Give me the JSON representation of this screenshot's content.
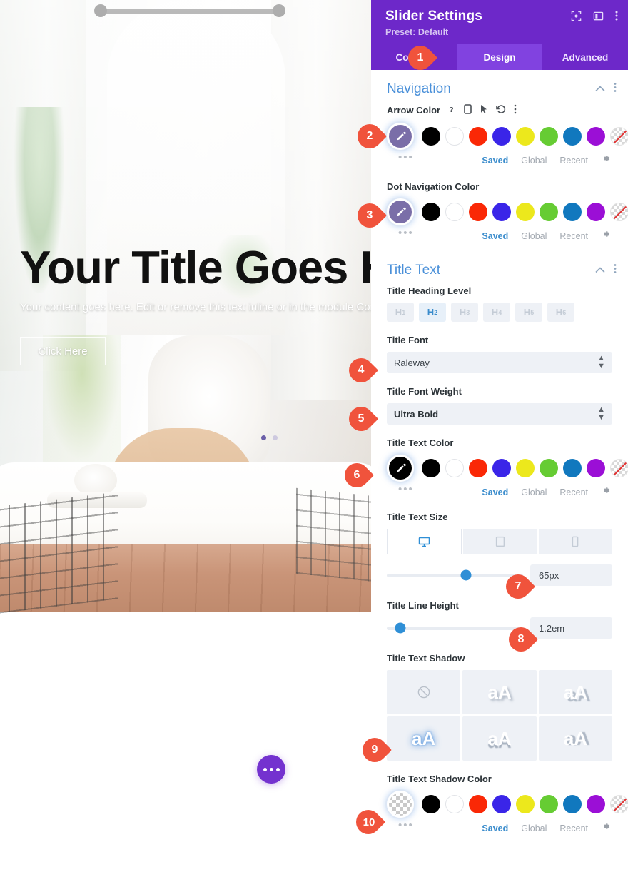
{
  "preview": {
    "title": "Your Title Goes Here",
    "body": "Your content goes here. Edit or remove this text inline or in the module Content settings. You can also style every aspect of this content in the module Design settings and even apply custom CSS to this text in the module Advanced settings.",
    "button_label": "Click Here",
    "fab_name": "more-options",
    "dots": [
      "active",
      "inactive"
    ]
  },
  "panel": {
    "title": "Slider Settings",
    "preset": "Preset: Default",
    "header_icons": [
      "focus-icon",
      "layout-icon",
      "kebab-menu-icon"
    ],
    "tabs": [
      {
        "label": "Content",
        "active": false
      },
      {
        "label": "Design",
        "active": true
      },
      {
        "label": "Advanced",
        "active": false
      }
    ]
  },
  "colors": {
    "accent_purple": "#6d28c9",
    "tab_active": "#8142e0",
    "section_blue": "#4a90d9",
    "badge_red": "#f0533c",
    "slider_knob": "#2f8fd6",
    "palette": [
      "#000000",
      "#ffffff",
      "#fa2806",
      "#3a25e8",
      "#ece81c",
      "#66cc33",
      "#1178be",
      "#9b0fd6",
      "transparent"
    ]
  },
  "palette_labels": [
    "black",
    "white",
    "red",
    "blue",
    "yellow",
    "green",
    "teal-blue",
    "purple",
    "transparent"
  ],
  "meta_row": {
    "saved": "Saved",
    "global": "Global",
    "recent": "Recent",
    "gear": "settings-gear-icon"
  },
  "navigation": {
    "section_title": "Navigation",
    "arrow_color": {
      "label": "Arrow Color",
      "icons": [
        "help-icon",
        "responsive-icon",
        "hover-icon",
        "reset-icon",
        "kebab-menu-icon"
      ],
      "selected": "#7a6ea8"
    },
    "dot_navigation_color": {
      "label": "Dot Navigation Color",
      "selected": "#7a6ea8"
    }
  },
  "title_text": {
    "section_title": "Title Text",
    "heading_level": {
      "label": "Title Heading Level",
      "options": [
        "H1",
        "H2",
        "H3",
        "H4",
        "H5",
        "H6"
      ],
      "selected": "H2"
    },
    "font": {
      "label": "Title Font",
      "value": "Raleway"
    },
    "font_weight": {
      "label": "Title Font Weight",
      "value": "Ultra Bold"
    },
    "text_color": {
      "label": "Title Text Color",
      "selected": "#000000"
    },
    "text_size": {
      "label": "Title Text Size",
      "value": "65px",
      "slider_percent": 58,
      "devices": [
        "desktop",
        "tablet",
        "phone"
      ],
      "active_device": "desktop"
    },
    "line_height": {
      "label": "Title Line Height",
      "value": "1.2em",
      "slider_percent": 10
    },
    "text_shadow": {
      "label": "Title Text Shadow",
      "presets": [
        "none",
        "aA",
        "aA",
        "aA",
        "aA",
        "aA"
      ],
      "selected_index": 3
    },
    "shadow_color": {
      "label": "Title Text Shadow Color",
      "selected": "transparent"
    }
  },
  "badges": [
    {
      "n": "1"
    },
    {
      "n": "2"
    },
    {
      "n": "3"
    },
    {
      "n": "4"
    },
    {
      "n": "5"
    },
    {
      "n": "6"
    },
    {
      "n": "7"
    },
    {
      "n": "8"
    },
    {
      "n": "9"
    },
    {
      "n": "10"
    }
  ]
}
